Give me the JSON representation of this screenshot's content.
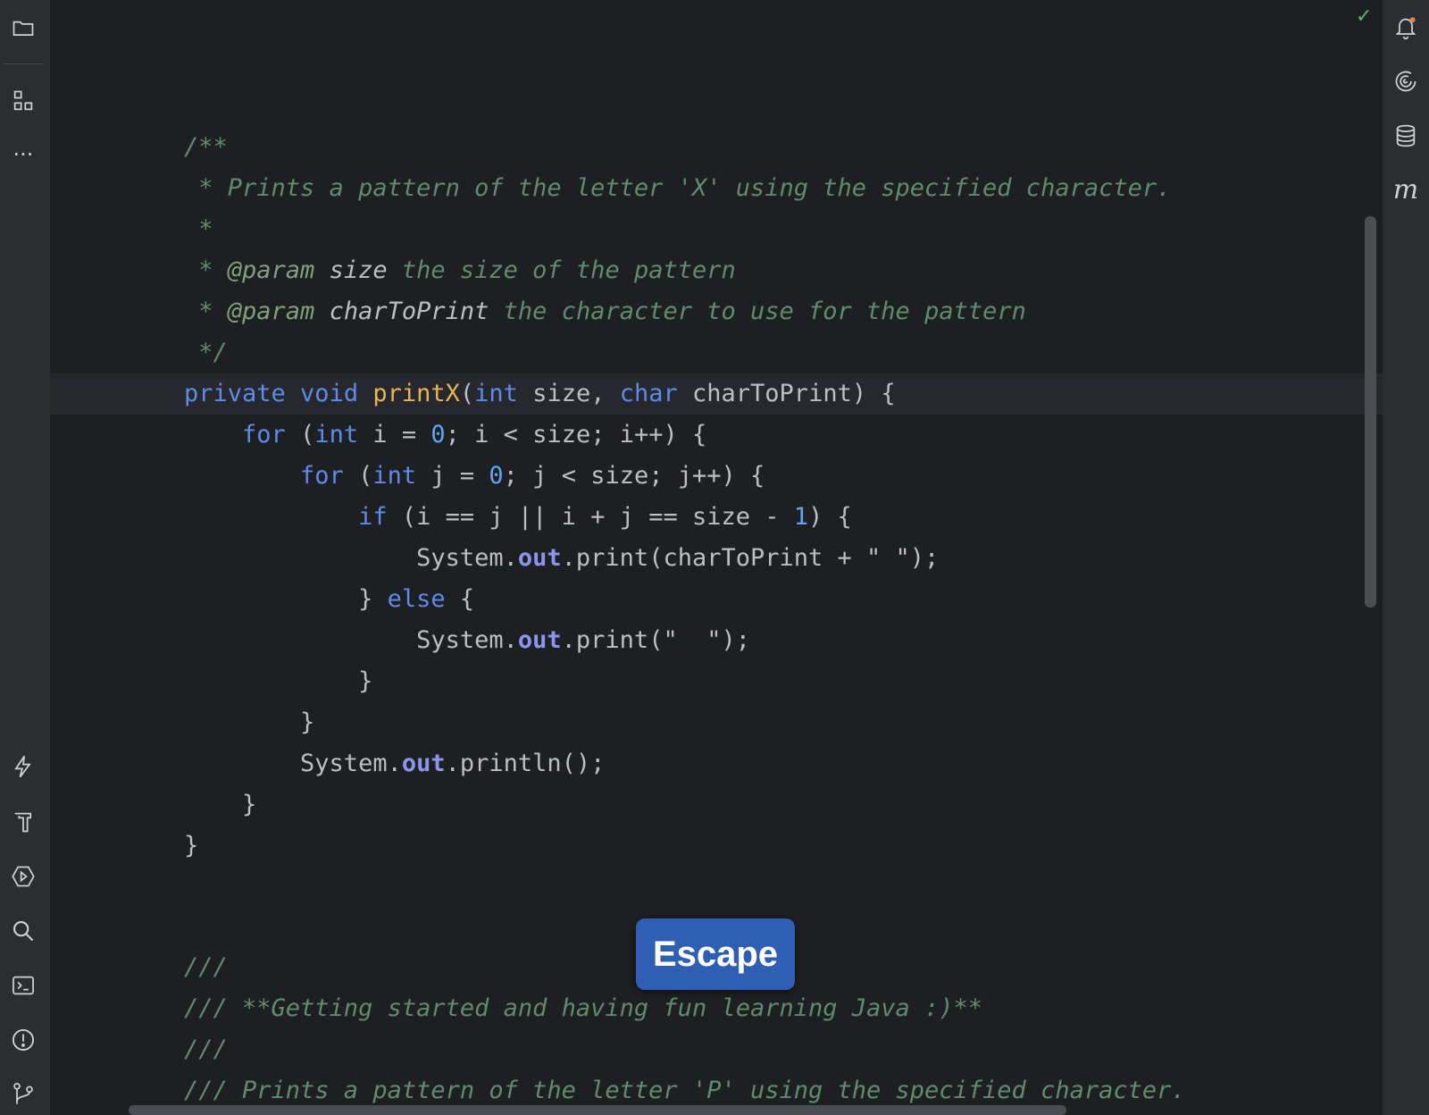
{
  "sidebar_left": {
    "icons": [
      "folder-icon",
      "structure-icon",
      "more-icon",
      "lightning-icon",
      "hammer-icon",
      "run-icon",
      "search-icon",
      "terminal-icon",
      "problems-icon",
      "git-icon"
    ],
    "more_label": "···"
  },
  "sidebar_right": {
    "icons": [
      "notifications-icon",
      "swirl-icon",
      "database-icon",
      "maven-icon"
    ],
    "maven_label": "m"
  },
  "editor": {
    "status_check": "✓",
    "doc_x": {
      "open": "/**",
      "summary": " * Prints a pattern of the letter 'X' using the specified character.",
      "blank": " *",
      "param1_star": " * ",
      "param1_tag": "@param",
      "param1_name": " size",
      "param1_desc": " the size of the pattern",
      "param2_star": " * ",
      "param2_tag": "@param",
      "param2_name": " charToPrint",
      "param2_desc": " the character to use for the pattern",
      "close": " */"
    },
    "code": {
      "l1_private": "private",
      "l1_void": " void ",
      "l1_name": "printX",
      "l1_open": "(",
      "l1_int": "int",
      "l1_size": " size, ",
      "l1_char": "char",
      "l1_rest": " charToPrint) {",
      "l2_indent": "    ",
      "l2_for": "for",
      "l2_open": " (",
      "l2_int": "int",
      "l2_mid": " i = ",
      "l2_zero": "0",
      "l2_rest": "; i < size; i++) {",
      "l3_indent": "        ",
      "l3_for": "for",
      "l3_open": " (",
      "l3_int": "int",
      "l3_mid": " j = ",
      "l3_zero": "0",
      "l3_rest": "; j < size; j++) {",
      "l4_indent": "            ",
      "l4_if": "if",
      "l4_mid": " (i == j || i + j == size - ",
      "l4_one": "1",
      "l4_rest": ") {",
      "l5_pre": "                System.",
      "l5_out": "out",
      "l5_rest": ".print(charToPrint + \" \");",
      "l6_pre": "            } ",
      "l6_else": "else",
      "l6_rest": " {",
      "l7_pre": "                System.",
      "l7_out": "out",
      "l7_rest": ".print(\"  \");",
      "l8": "            }",
      "l9": "        }",
      "l10_pre": "        System.",
      "l10_out": "out",
      "l10_rest": ".println();",
      "l11": "    }",
      "l12": "}"
    },
    "doc_p": {
      "l1": "///",
      "l2": "/// **Getting started and having fun learning Java :)**",
      "l3": "///",
      "l4": "/// Prints a pattern of the letter 'P' using the specified character."
    }
  },
  "overlay": {
    "key_label": "Escape"
  }
}
